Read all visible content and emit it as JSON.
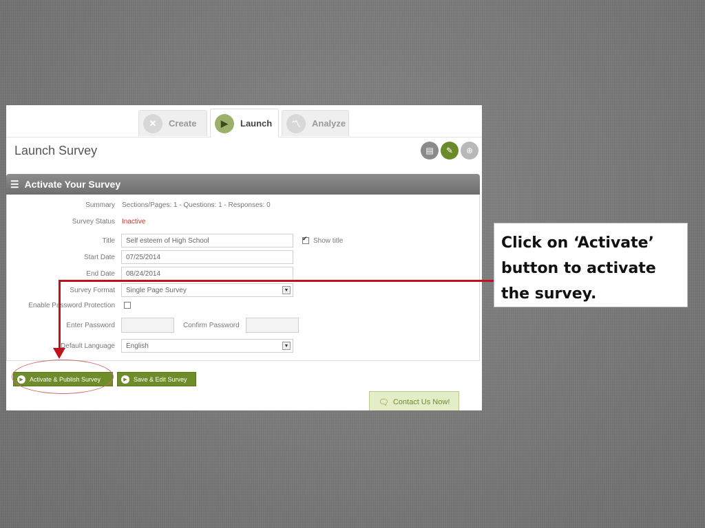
{
  "tabs": [
    {
      "label": "Create",
      "icon": "tools-icon"
    },
    {
      "label": "Launch",
      "icon": "play-icon"
    },
    {
      "label": "Analyze",
      "icon": "chart-line-icon"
    }
  ],
  "header": {
    "title": "Launch Survey",
    "icons": [
      "document-icon",
      "edit-icon",
      "globe-icon"
    ]
  },
  "panel": {
    "title": "Activate Your Survey",
    "summary_label": "Summary",
    "summary_value": "Sections/Pages: 1 - Questions: 1 - Responses: 0",
    "status_label": "Survey Status",
    "status_value": "Inactive",
    "title_label": "Title",
    "title_value": "Self esteem of High School",
    "show_title_label": "Show title",
    "start_label": "Start Date",
    "start_value": "07/25/2014",
    "end_label": "End Date",
    "end_value": "08/24/2014",
    "format_label": "Survey Format",
    "format_value": "Single Page Survey",
    "password_protect_label": "Enable Password Protection",
    "enter_password_label": "Enter Password",
    "confirm_password_label": "Confirm Password",
    "language_label": "Default Language",
    "language_value": "English"
  },
  "buttons": {
    "activate": "Activate & Publish Survey",
    "save": "Save & Edit Survey",
    "contact": "Contact Us Now!"
  },
  "callout": {
    "line1": "Click on ‘Activate’",
    "line2": "button to activate",
    "line3": "the survey."
  },
  "colors": {
    "accent_green": "#6f8c2b",
    "status_red": "#c0392b",
    "arrow_red": "#c0121a"
  }
}
